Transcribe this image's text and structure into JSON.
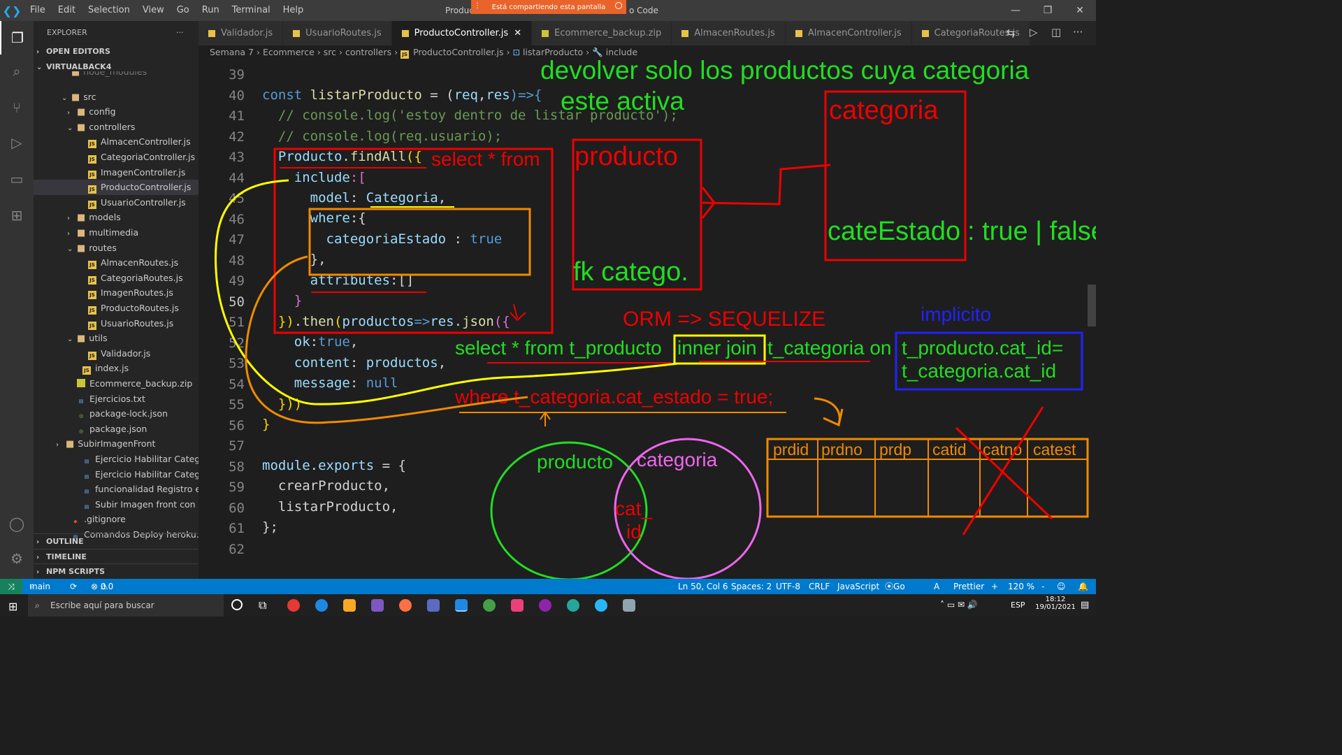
{
  "menubar": {
    "items": [
      "File",
      "Edit",
      "Selection",
      "View",
      "Go",
      "Run",
      "Terminal",
      "Help"
    ],
    "title_left": "Produc",
    "title_right": "o Code",
    "share_text": "Está compartiendo esta pantalla"
  },
  "sidebar": {
    "header": "EXPLORER",
    "open_editors": "OPEN EDITORS",
    "workspace": "VIRTUALBACK4",
    "rows": [
      {
        "label": "node_modules",
        "type": "folder"
      },
      {
        "label": "src",
        "type": "folder"
      },
      {
        "label": "config",
        "type": "folder"
      },
      {
        "label": "controllers",
        "type": "folder"
      },
      {
        "label": "AlmacenController.js",
        "type": "js"
      },
      {
        "label": "CategoriaController.js",
        "type": "js"
      },
      {
        "label": "ImagenController.js",
        "type": "js"
      },
      {
        "label": "ProductoController.js",
        "type": "js"
      },
      {
        "label": "UsuarioController.js",
        "type": "js"
      },
      {
        "label": "models",
        "type": "folder"
      },
      {
        "label": "multimedia",
        "type": "folder"
      },
      {
        "label": "routes",
        "type": "folder"
      },
      {
        "label": "AlmacenRoutes.js",
        "type": "js"
      },
      {
        "label": "CategoriaRoutes.js",
        "type": "js"
      },
      {
        "label": "ImagenRoutes.js",
        "type": "js"
      },
      {
        "label": "ProductoRoutes.js",
        "type": "js"
      },
      {
        "label": "UsuarioRoutes.js",
        "type": "js"
      },
      {
        "label": "utils",
        "type": "folder"
      },
      {
        "label": "Validador.js",
        "type": "js"
      },
      {
        "label": "index.js",
        "type": "js"
      },
      {
        "label": "Ecommerce_backup.zip",
        "type": "zip"
      },
      {
        "label": "Ejercicios.txt",
        "type": "txt"
      },
      {
        "label": "package-lock.json",
        "type": "json"
      },
      {
        "label": "package.json",
        "type": "json"
      },
      {
        "label": "SubirImagenFront",
        "type": "folder"
      },
      {
        "label": "Ejercicio Habilitar Categoria a...",
        "type": "doc"
      },
      {
        "label": "Ejercicio Habilitar Categoria.p...",
        "type": "doc"
      },
      {
        "label": "funcionalidad Registro e inici...",
        "type": "doc"
      },
      {
        "label": "Subir Imagen front con back....",
        "type": "doc"
      },
      {
        "label": ".gitignore",
        "type": "git"
      },
      {
        "label": "Comandos Deploy heroku.txt",
        "type": "txt"
      }
    ],
    "outline": "OUTLINE",
    "timeline": "TIMELINE",
    "npm": "NPM SCRIPTS"
  },
  "tabs": [
    "Validador.js",
    "UsuarioRoutes.js",
    "ProductoController.js",
    "Ecommerce_backup.zip",
    "AlmacenRoutes.js",
    "AlmacenController.js",
    "CategoriaRoutes.js"
  ],
  "breadcrumb": [
    "Semana 7",
    "Ecommerce",
    "src",
    "controllers",
    "ProductoController.js",
    "listarProducto",
    "include"
  ],
  "line_numbers": [
    "39",
    "40",
    "41",
    "42",
    "43",
    "44",
    "45",
    "46",
    "47",
    "48",
    "49",
    "50",
    "51",
    "52",
    "53",
    "54",
    "55",
    "56",
    "57",
    "58",
    "59",
    "60",
    "61",
    "62"
  ],
  "code": {
    "l40a": "const ",
    "l40b": "listarProducto",
    "l40c": " = (",
    "l40d": "req",
    "l40e": ",",
    "l40f": "res",
    "l40g": ")=>{",
    "l41": "  // console.log('estoy dentro de listar producto');",
    "l42": "  // console.log(req.usuario);",
    "l43a": "  Producto",
    "l43b": ".",
    "l43c": "findAll",
    "l43d": "({",
    "l44a": "    include",
    "l44b": ":[",
    "l45a": "      model",
    "l45b": ": ",
    "l45c": "Categoria",
    ",": ",",
    "l46a": "      where",
    "l46b": ":{",
    "l47a": "        categoriaEstado",
    "l47b": " : ",
    "l47c": "true",
    "l48": "      },",
    "l49a": "      attributes",
    "l49b": ":[]",
    "l50": "    }",
    "l51a": "  })",
    "l51b": ".",
    "l51c": "then",
    "l51d": "(",
    "l51e": "productos",
    "l51f": "=>",
    "l51g": "res",
    "l51h": ".",
    "l51i": "json",
    "l51j": "({",
    "l52a": "    ok",
    "l52b": ":",
    "l52c": "true",
    ",2": ",",
    "l53a": "    content",
    "l53b": ": ",
    "l53c": "productos",
    ",3": ",",
    "l54a": "    message",
    "l54b": ": ",
    "l54c": "null",
    "l55": "  }))",
    "l56": "}",
    "l58a": "module",
    "l58b": ".",
    "l58c": "exports",
    "l58d": " = {",
    "l59": "  crearProducto,",
    "l60": "  listarProducto,",
    "l61": "};"
  },
  "annotations": {
    "title1": "devolver solo los productos cuya categoria",
    "title2": "este activa",
    "select_from": "select * from",
    "producto": "producto",
    "fk": "fk catego.",
    "categoria": "categoria",
    "cateEstado": "cateEstado",
    "true_false": ": true | false",
    "orm": "ORM => SEQUELIZE",
    "implicito": "implicito",
    "sql1": "select * from t_producto",
    "inner_join": "inner join",
    "sql2": "t_categoria on",
    "sql3": "t_producto.cat_id=",
    "sql4": "t_categoria.cat_id",
    "sql_where": "where t_categoria.cat_estado = true;",
    "venn_producto": "producto",
    "venn_categoria": "categoria",
    "venn_cat": "cat_",
    "venn_id": "id",
    "table_headers": [
      "prdid",
      "prdno",
      "prdp",
      "catid",
      "catno",
      "catest"
    ]
  },
  "statusbar": {
    "branch": "main",
    "errors": "0",
    "warnings": "0",
    "position": "Ln 50, Col 6",
    "spaces": "Spaces: 2",
    "encoding": "UTF-8",
    "eol": "CRLF",
    "language": "JavaScript",
    "golive": "Go Live",
    "prettier": "Prettier",
    "zoom": "120 %"
  },
  "taskbar": {
    "search": "Escribe aquí para buscar",
    "lang": "ESP",
    "time": "18:12",
    "date": "19/01/2021"
  }
}
